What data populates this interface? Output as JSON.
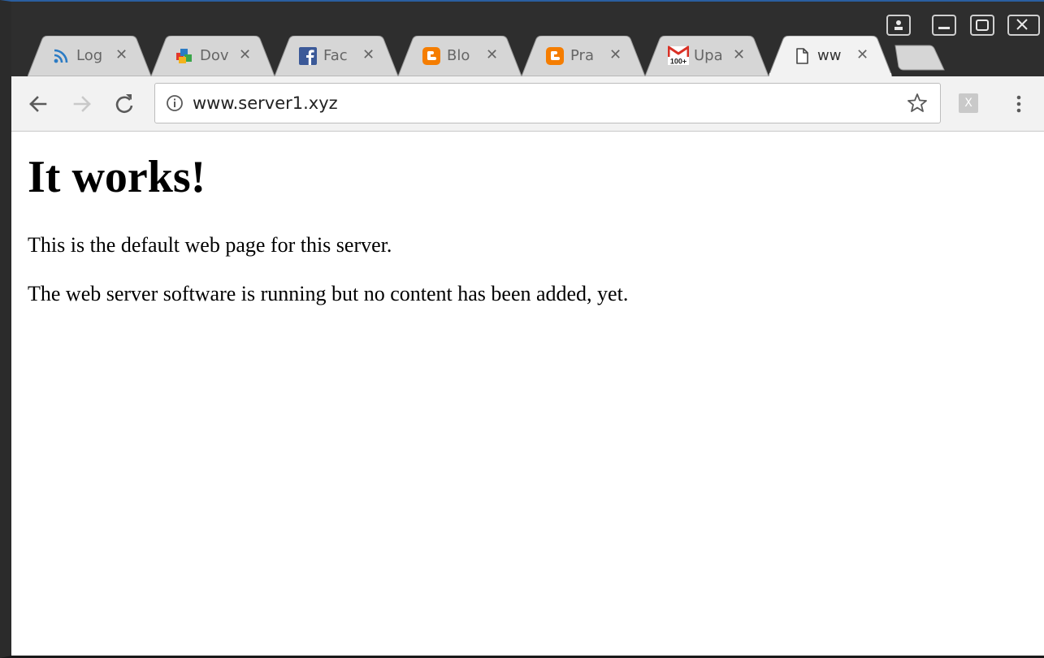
{
  "tabs": [
    {
      "title": "Log",
      "icon": "rss-icon",
      "close": "✕"
    },
    {
      "title": "Dov",
      "icon": "download-icon",
      "close": "✕"
    },
    {
      "title": "Fac",
      "icon": "facebook-icon",
      "close": "✕"
    },
    {
      "title": "Blo",
      "icon": "blogger-icon",
      "close": "✕"
    },
    {
      "title": "Pra",
      "icon": "blogger-icon",
      "close": "✕"
    },
    {
      "title": "Upa",
      "icon": "gmail-icon",
      "badge": "100+",
      "close": "✕"
    },
    {
      "title": "ww",
      "icon": "page-icon",
      "close": "✕",
      "active": true
    }
  ],
  "toolbar": {
    "url": "www.server1.xyz",
    "extension_label": "X"
  },
  "page": {
    "heading": "It works!",
    "paragraphs": [
      "This is the default web page for this server.",
      "The web server software is running but no content has been added, yet."
    ]
  },
  "colors": {
    "frame": "#2e2e2e",
    "tab_inactive": "#d6d6d6",
    "tab_active": "#f2f2f2",
    "rss": "#2b7bc4",
    "facebook": "#3b5998",
    "blogger": "#f57d00",
    "gmail": "#d93025"
  }
}
